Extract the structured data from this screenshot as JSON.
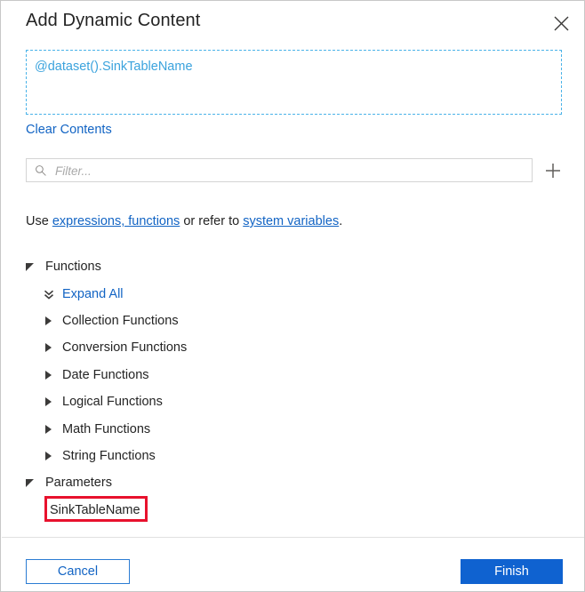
{
  "dialog": {
    "title": "Add Dynamic Content",
    "close_label": "Close"
  },
  "expression": {
    "value": "@dataset().SinkTableName",
    "clear_label": "Clear Contents"
  },
  "filter": {
    "placeholder": "Filter...",
    "value": "",
    "icon": "search-icon",
    "add_icon": "plus-icon"
  },
  "hint": {
    "prefix": "Use ",
    "link1": "expressions, functions",
    "middle": " or refer to ",
    "link2": "system variables",
    "suffix": "."
  },
  "tree": {
    "functions": {
      "label": "Functions",
      "expand_all_label": "Expand All",
      "children": [
        {
          "label": "Collection Functions"
        },
        {
          "label": "Conversion Functions"
        },
        {
          "label": "Date Functions"
        },
        {
          "label": "Logical Functions"
        },
        {
          "label": "Math Functions"
        },
        {
          "label": "String Functions"
        }
      ]
    },
    "parameters": {
      "label": "Parameters",
      "children": [
        {
          "label": "SinkTableName",
          "highlighted": true
        }
      ]
    }
  },
  "footer": {
    "cancel_label": "Cancel",
    "finish_label": "Finish"
  },
  "colors": {
    "accent": "#0f62d0",
    "link": "#1264c4",
    "expression_text": "#3ba3dd",
    "expression_border": "#4ab3e8",
    "highlight": "#e8112d"
  }
}
